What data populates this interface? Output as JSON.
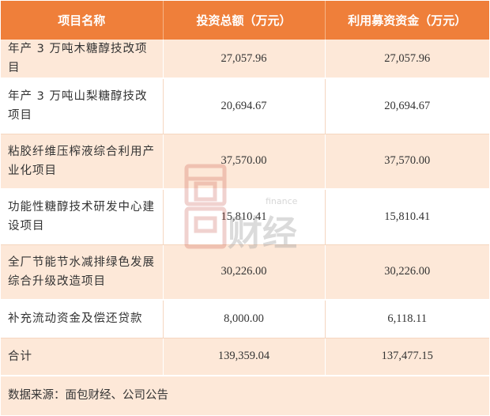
{
  "table": {
    "headers": [
      "项目名称",
      "投资总额（万元）",
      "利用募资资金（万元）"
    ],
    "rows": [
      {
        "name": "年产 3 万吨木糖醇技改项目",
        "total": "27,057.96",
        "raised": "27,057.96"
      },
      {
        "name": "年产 3 万吨山梨糖醇技改项目",
        "total": "20,694.67",
        "raised": "20,694.67"
      },
      {
        "name": "粘胶纤维压榨液综合利用产业化项目",
        "total": "37,570.00",
        "raised": "37,570.00"
      },
      {
        "name": "功能性糖醇技术研发中心建设项目",
        "total": "15,810.41",
        "raised": "15,810.41"
      },
      {
        "name": "全厂节能节水减排绿色发展综合升级改造项目",
        "total": "30,226.00",
        "raised": "30,226.00"
      },
      {
        "name": "补充流动资金及偿还贷款",
        "total": "8,000.00",
        "raised": "6,118.11"
      },
      {
        "name": "合计",
        "total": "139,359.04",
        "raised": "137,477.15"
      }
    ]
  },
  "source_note": "数据来源：面包财经、公司公告",
  "watermark": {
    "brand": "面包财经",
    "sub": "finance"
  },
  "colors": {
    "header": "#ef7f3a",
    "band": "#fde8d8",
    "watermark": "#c0392b"
  }
}
